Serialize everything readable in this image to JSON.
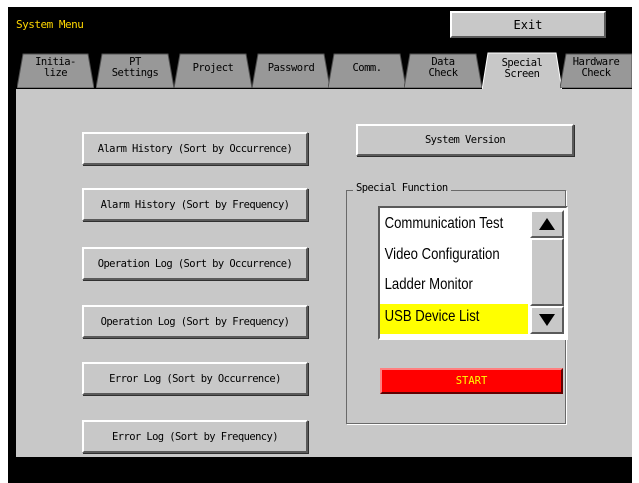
{
  "header": {
    "title": "System Menu",
    "exit_label": "Exit"
  },
  "tabs": [
    {
      "label": "Initia-\nlize"
    },
    {
      "label": "PT\nSettings"
    },
    {
      "label": "Project"
    },
    {
      "label": "Password"
    },
    {
      "label": "Comm."
    },
    {
      "label": "Data\nCheck"
    },
    {
      "label": "Special\nScreen",
      "active": true
    },
    {
      "label": "Hardware\nCheck"
    }
  ],
  "left_buttons": [
    {
      "label": "Alarm History (Sort by Occurrence)"
    },
    {
      "label": "Alarm History (Sort by Frequency)"
    },
    {
      "label": "Operation Log (Sort by Occurrence)"
    },
    {
      "label": "Operation Log (Sort by Frequency)"
    },
    {
      "label": "Error Log (Sort by Occurrence)"
    },
    {
      "label": "Error Log (Sort by Frequency)"
    }
  ],
  "system_version_label": "System Version",
  "special_function": {
    "group_label": "Special Function",
    "items": [
      "Communication Test",
      "Video Configuration",
      "Ladder Monitor",
      "USB Device List"
    ],
    "selected": "USB Device List",
    "start_label": "START"
  },
  "icons": {
    "scroll_up": "triangle-up-icon",
    "scroll_down": "triangle-down-icon"
  },
  "colors": {
    "title_text": "#ffd700",
    "background": "#c8c8c8",
    "selection": "#ffff00",
    "start_button": "#ff0000",
    "start_text": "#ffff00"
  }
}
